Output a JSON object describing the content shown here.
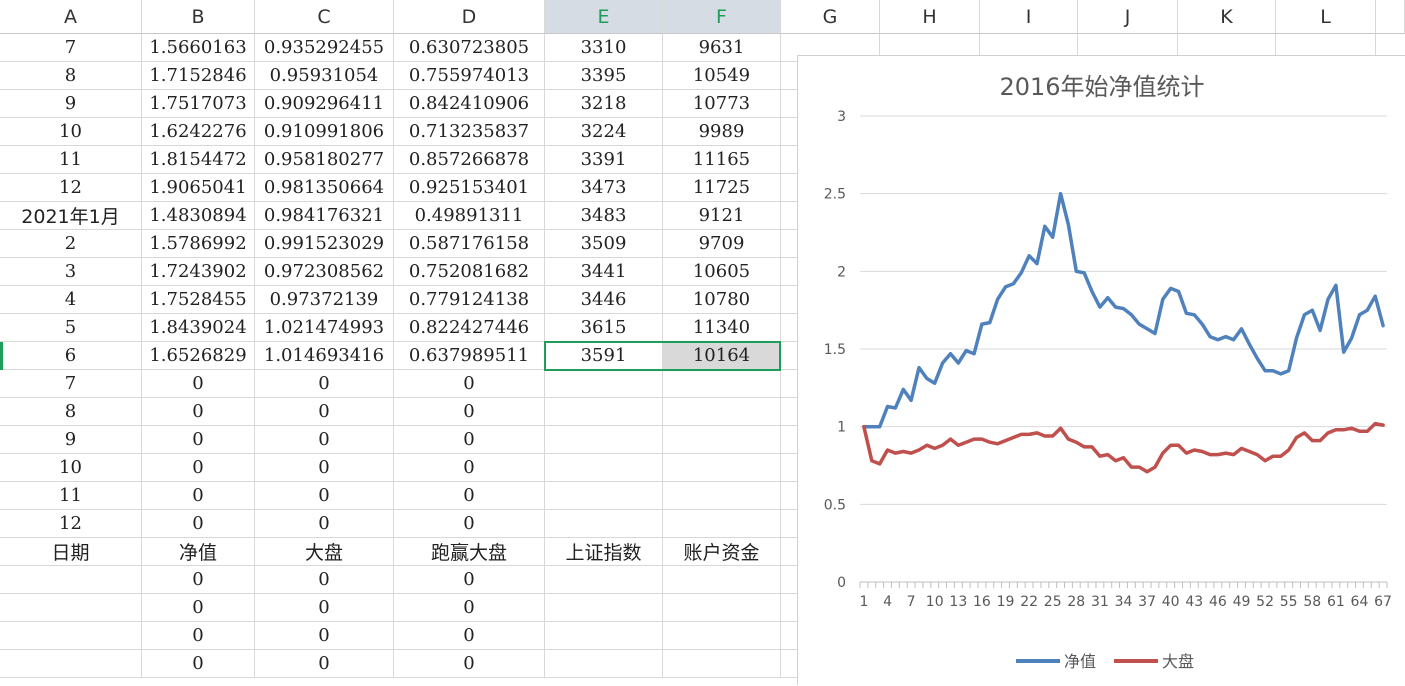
{
  "sheet": {
    "columns": [
      "A",
      "B",
      "C",
      "D",
      "E",
      "F",
      "G",
      "H",
      "I",
      "J",
      "K",
      "L"
    ],
    "selected_columns": [
      "E",
      "F"
    ],
    "rows": [
      [
        "7",
        "1.5660163",
        "0.935292455",
        "0.630723805",
        "3310",
        "9631"
      ],
      [
        "8",
        "1.7152846",
        "0.95931054",
        "0.755974013",
        "3395",
        "10549"
      ],
      [
        "9",
        "1.7517073",
        "0.909296411",
        "0.842410906",
        "3218",
        "10773"
      ],
      [
        "10",
        "1.6242276",
        "0.910991806",
        "0.713235837",
        "3224",
        "9989"
      ],
      [
        "11",
        "1.8154472",
        "0.958180277",
        "0.857266878",
        "3391",
        "11165"
      ],
      [
        "12",
        "1.9065041",
        "0.981350664",
        "0.925153401",
        "3473",
        "11725"
      ],
      [
        "2021年1月",
        "1.4830894",
        "0.984176321",
        "0.49891311",
        "3483",
        "9121"
      ],
      [
        "2",
        "1.5786992",
        "0.991523029",
        "0.587176158",
        "3509",
        "9709"
      ],
      [
        "3",
        "1.7243902",
        "0.972308562",
        "0.752081682",
        "3441",
        "10605"
      ],
      [
        "4",
        "1.7528455",
        "0.97372139",
        "0.779124138",
        "3446",
        "10780"
      ],
      [
        "5",
        "1.8439024",
        "1.021474993",
        "0.822427446",
        "3615",
        "11340"
      ],
      [
        "6",
        "1.6526829",
        "1.014693416",
        "0.637989511",
        "3591",
        "10164"
      ],
      [
        "7",
        "0",
        "0",
        "0",
        "",
        ""
      ],
      [
        "8",
        "0",
        "0",
        "0",
        "",
        ""
      ],
      [
        "9",
        "0",
        "0",
        "0",
        "",
        ""
      ],
      [
        "10",
        "0",
        "0",
        "0",
        "",
        ""
      ],
      [
        "11",
        "0",
        "0",
        "0",
        "",
        ""
      ],
      [
        "12",
        "0",
        "0",
        "0",
        "",
        ""
      ],
      [
        "日期",
        "净值",
        "大盘",
        "跑赢大盘",
        "上证指数",
        "账户资金"
      ],
      [
        "",
        "0",
        "0",
        "0",
        "",
        ""
      ],
      [
        "",
        "0",
        "0",
        "0",
        "",
        ""
      ],
      [
        "",
        "0",
        "0",
        "0",
        "",
        ""
      ],
      [
        "",
        "0",
        "0",
        "0",
        "",
        ""
      ]
    ]
  },
  "chart_data": {
    "type": "line",
    "title": "2016年始净值统计",
    "ylim": [
      0,
      3
    ],
    "yticks": [
      "0",
      "0.5",
      "1",
      "1.5",
      "2",
      "2.5",
      "3"
    ],
    "xtick_labels": [
      "1",
      "4",
      "7",
      "10",
      "13",
      "16",
      "19",
      "22",
      "25",
      "28",
      "31",
      "34",
      "37",
      "40",
      "43",
      "46",
      "49",
      "52",
      "55",
      "58",
      "61",
      "64",
      "67"
    ],
    "x_count": 67,
    "grid": true,
    "legend": "bottom",
    "series": [
      {
        "name": "净值",
        "color": "#4f81bd",
        "values": [
          1,
          1,
          1,
          1.13,
          1.12,
          1.24,
          1.17,
          1.38,
          1.31,
          1.28,
          1.41,
          1.47,
          1.41,
          1.49,
          1.47,
          1.66,
          1.67,
          1.82,
          1.9,
          1.92,
          1.99,
          2.1,
          2.05,
          2.29,
          2.22,
          2.5,
          2.3,
          2,
          1.99,
          1.87,
          1.77,
          1.83,
          1.77,
          1.76,
          1.72,
          1.66,
          1.63,
          1.6,
          1.82,
          1.89,
          1.87,
          1.73,
          1.72,
          1.66,
          1.58,
          1.56,
          1.58,
          1.56,
          1.63,
          1.53,
          1.44,
          1.36,
          1.36,
          1.34,
          1.36,
          1.57,
          1.72,
          1.75,
          1.62,
          1.82,
          1.91,
          1.48,
          1.57,
          1.72,
          1.75,
          1.84,
          1.65
        ]
      },
      {
        "name": "大盘",
        "color": "#c0504d",
        "values": [
          1,
          0.78,
          0.76,
          0.85,
          0.83,
          0.84,
          0.83,
          0.85,
          0.88,
          0.86,
          0.88,
          0.92,
          0.88,
          0.9,
          0.92,
          0.92,
          0.9,
          0.89,
          0.91,
          0.93,
          0.95,
          0.95,
          0.96,
          0.94,
          0.94,
          0.99,
          0.92,
          0.9,
          0.87,
          0.87,
          0.81,
          0.82,
          0.78,
          0.8,
          0.74,
          0.74,
          0.71,
          0.74,
          0.83,
          0.88,
          0.88,
          0.83,
          0.85,
          0.84,
          0.82,
          0.82,
          0.83,
          0.82,
          0.86,
          0.84,
          0.82,
          0.78,
          0.81,
          0.81,
          0.85,
          0.93,
          0.96,
          0.91,
          0.91,
          0.96,
          0.98,
          0.98,
          0.99,
          0.97,
          0.97,
          1.02,
          1.01
        ]
      }
    ]
  }
}
